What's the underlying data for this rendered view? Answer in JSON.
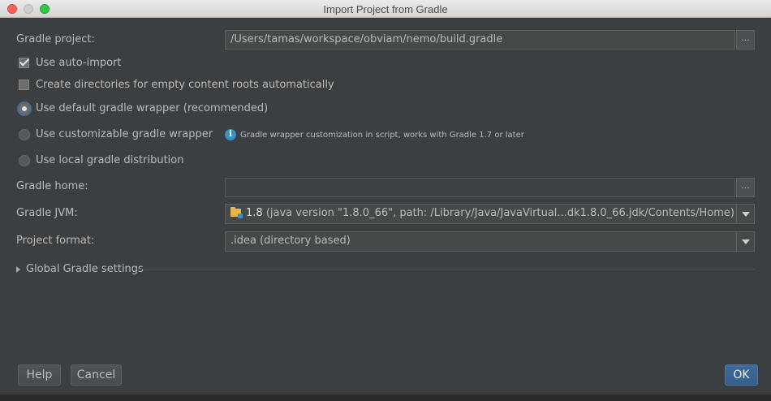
{
  "window": {
    "title": "Import Project from Gradle"
  },
  "gradle_project": {
    "label": "Gradle project:",
    "value": "/Users/tamas/workspace/obviam/nemo/build.gradle",
    "browse": "..."
  },
  "options": {
    "auto_import": {
      "label": "Use auto-import",
      "checked": true
    },
    "create_dirs": {
      "label": "Create directories for empty content roots automatically",
      "checked": false
    }
  },
  "wrapper": {
    "default": {
      "label": "Use default gradle wrapper (recommended)",
      "selected": true
    },
    "customizable": {
      "label": "Use customizable gradle wrapper",
      "selected": false
    },
    "local": {
      "label": "Use local gradle distribution",
      "selected": false
    },
    "info": "Gradle wrapper customization in script, works with Gradle 1.7 or later"
  },
  "gradle_home": {
    "label": "Gradle home:",
    "value": "",
    "browse": "..."
  },
  "gradle_jvm": {
    "label": "Gradle JVM:",
    "version": "1.8",
    "detail": "(java version \"1.8.0_66\", path: /Library/Java/JavaVirtual...dk1.8.0_66.jdk/Contents/Home)"
  },
  "project_format": {
    "label": "Project format:",
    "value": ".idea (directory based)"
  },
  "global_settings": {
    "label": "Global Gradle settings"
  },
  "buttons": {
    "help": "Help",
    "cancel": "Cancel",
    "ok": "OK"
  },
  "colors": {
    "background": "#3c3f41",
    "accent": "#365f8b",
    "info_icon": "#3592c4"
  }
}
